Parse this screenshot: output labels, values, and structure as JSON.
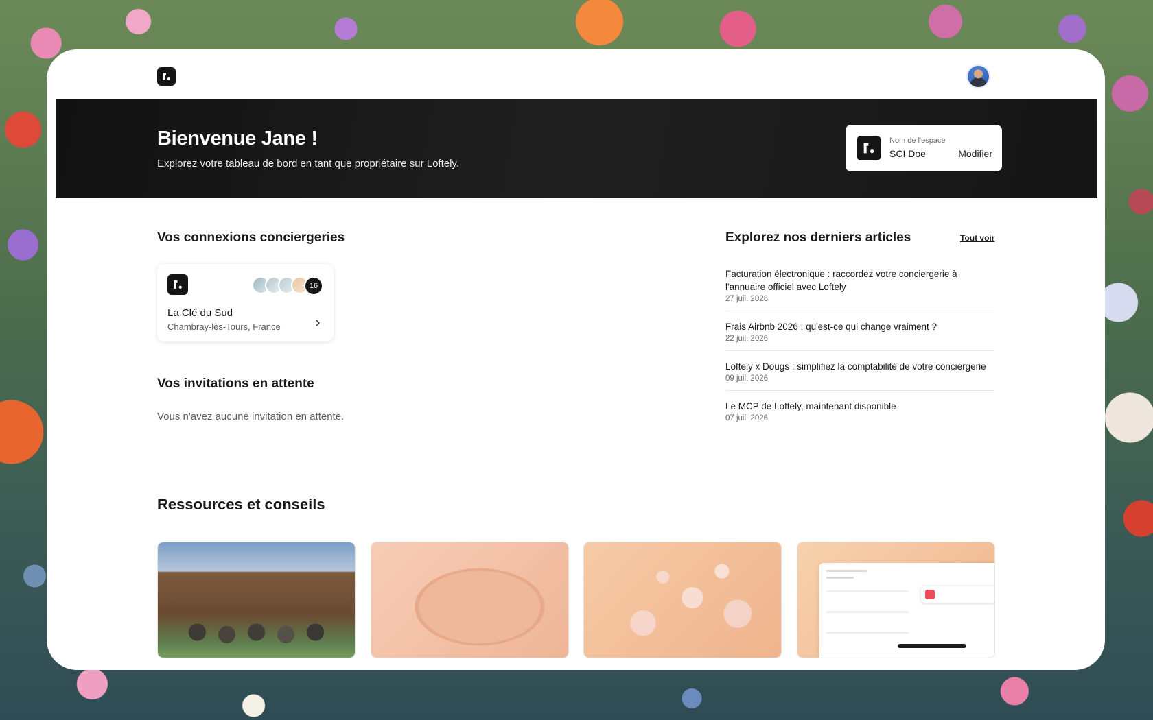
{
  "header": {
    "logo_icon": "loftely-logo-icon",
    "avatar_icon": "user-avatar-icon"
  },
  "hero": {
    "title": "Bienvenue Jane !",
    "subtitle": "Explorez votre tableau de bord en tant que propriétaire sur Loftely.",
    "space_label": "Nom de l'espace",
    "space_name": "SCI Doe",
    "edit_label": "Modifier"
  },
  "connections": {
    "title": "Vos connexions conciergeries",
    "items": [
      {
        "name": "La Clé du Sud",
        "location": "Chambray-lès-Tours, France",
        "member_count": "16"
      }
    ]
  },
  "invitations": {
    "title": "Vos invitations en attente",
    "empty_text": "Vous n'avez aucune invitation en attente."
  },
  "articles": {
    "title": "Explorez nos derniers articles",
    "see_all": "Tout voir",
    "items": [
      {
        "title": "Facturation électronique : raccordez votre conciergerie à l'annuaire officiel avec Loftely",
        "date": "27 juil. 2026"
      },
      {
        "title": "Frais Airbnb 2026 : qu'est-ce qui change vraiment ?",
        "date": "22 juil. 2026"
      },
      {
        "title": "Loftely x Dougs : simplifiez la comptabilité de votre conciergerie",
        "date": "09 juil. 2026"
      },
      {
        "title": "Le MCP de Loftely, maintenant disponible",
        "date": "07 juil. 2026"
      }
    ]
  },
  "resources": {
    "title": "Ressources et conseils"
  },
  "colors": {
    "hero_bg": "#151515",
    "card_bg": "#ffffff",
    "accent_dark": "#151515"
  }
}
